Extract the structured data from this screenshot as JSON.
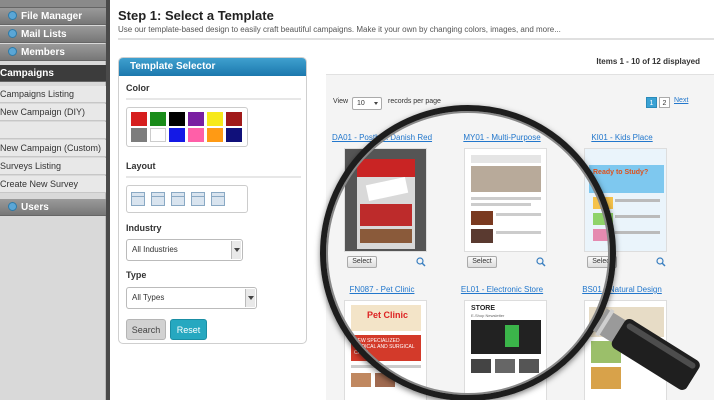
{
  "nav": {
    "headers": [
      {
        "label": "File Manager"
      },
      {
        "label": "Mail Lists"
      },
      {
        "label": "Members"
      },
      {
        "label": "Campaigns"
      },
      {
        "label": "Users"
      }
    ],
    "campaign_items": [
      "Campaigns Listing",
      "New Campaign (DIY)",
      "",
      "New Campaign (Custom)",
      "Surveys Listing",
      "Create New Survey"
    ]
  },
  "page": {
    "title": "Step 1: Select a Template",
    "subtitle": "Use our template-based design to easily craft beautiful campaigns. Make it your own by changing colors, images, and more..."
  },
  "panel": {
    "heading": "Template Selector",
    "color_label": "Color",
    "layout_label": "Layout",
    "industry_label": "Industry",
    "industry_value": "All Industries",
    "type_label": "Type",
    "type_value": "All Types",
    "search_button": "Search",
    "reset_button": "Reset",
    "colors": [
      "#d61e1e",
      "#1a8c1a",
      "#000000",
      "#7a1fa2",
      "#f7e91a",
      "#a11a1a",
      "#7d7d7d",
      "#ffffff",
      "#1419e6",
      "#ff5fa8",
      "#ff9a14",
      "#10107a"
    ]
  },
  "results": {
    "items_text": "Items 1 - 10 of 12 displayed",
    "view_label": "View",
    "per_page_value": "10",
    "records_label": "records per page",
    "pages": [
      "1",
      "2"
    ],
    "next_label": "Next",
    "select_label": "Select",
    "templates": [
      {
        "title": "DA01 - Postbox Danish Red"
      },
      {
        "title": "MY01 - Multi-Purpose"
      },
      {
        "title": "KI01 - Kids Place"
      },
      {
        "title": "FN087 - Pet Clinic"
      },
      {
        "title": "EL01 - Electronic Store"
      },
      {
        "title": "BS01 - Natural Design"
      }
    ]
  },
  "thumb_text": {
    "kids": "Ready to Study?",
    "pet": "Pet Clinic",
    "pet_banner": "NEW SPECIALIZED MEDICAL AND SURGICAL CARE",
    "store": "STORE",
    "store_sub": "E-Shop Newsletter"
  }
}
